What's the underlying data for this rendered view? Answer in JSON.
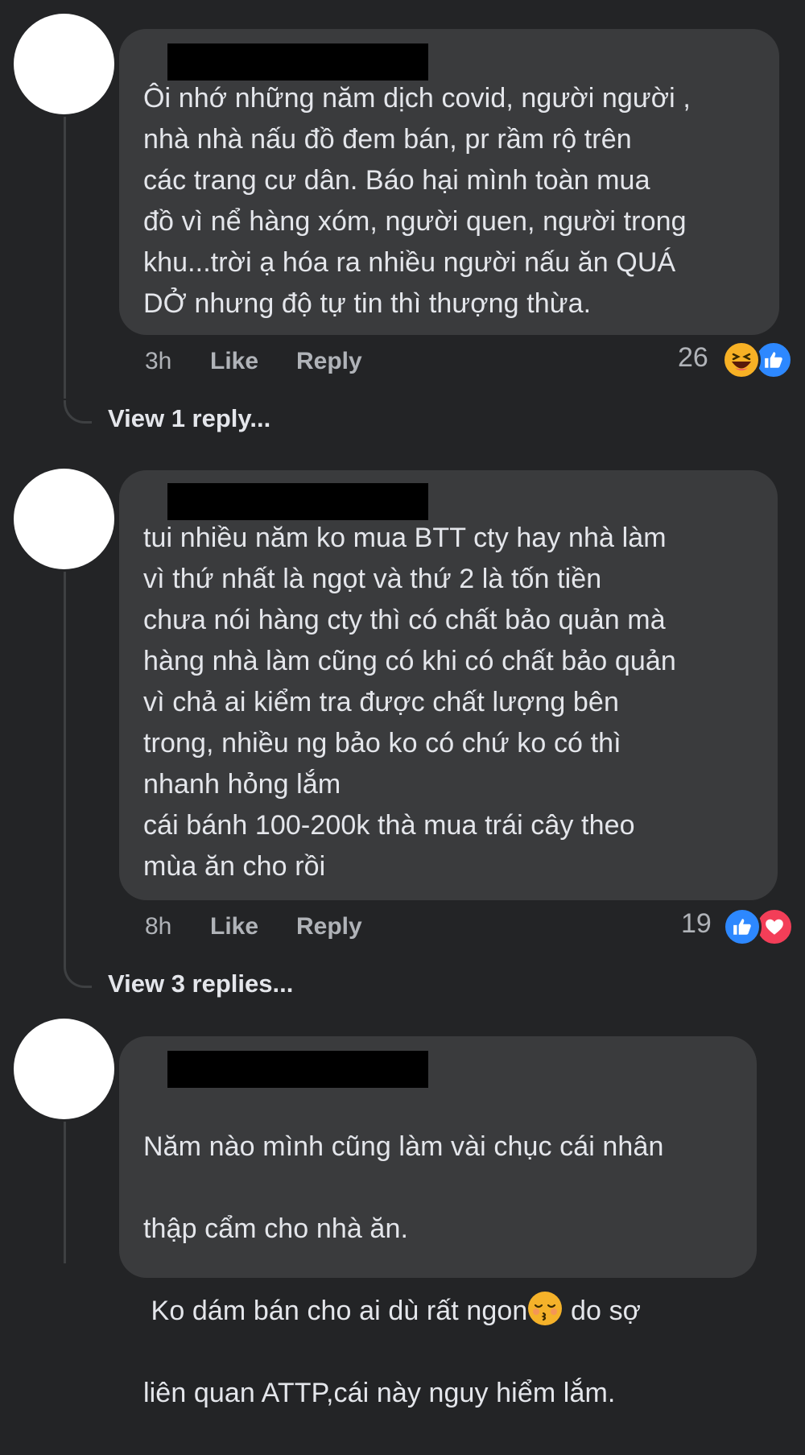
{
  "comments": [
    {
      "text": "Ôi nhớ những năm dịch covid, người người ,\nnhà nhà nấu đồ đem bán, pr rầm rộ trên\ncác trang cư dân. Báo hại mình toàn mua\nđồ vì nể hàng xóm, người quen, người trong\nkhu...trời ạ hóa ra nhiều người nấu ăn QUÁ\nDỞ nhưng độ tự tin thì thượng thừa.",
      "time": "3h",
      "like_label": "Like",
      "reply_label": "Reply",
      "reaction_count": "26",
      "reactions": [
        "haha-icon",
        "like-icon"
      ],
      "view_replies": "View 1 reply..."
    },
    {
      "text": "tui nhiều năm ko mua BTT cty hay nhà làm\nvì thứ nhất là ngọt và thứ 2 là tốn tiền\nchưa nói hàng cty thì có chất bảo quản mà\nhàng nhà làm cũng có khi có chất bảo quản\nvì chả ai kiểm tra được chất lượng bên\ntrong, nhiều ng bảo ko có chứ ko có thì\nnhanh hỏng lắm\ncái bánh 100-200k thà mua trái cây theo\nmùa ăn cho rồi",
      "time": "8h",
      "like_label": "Like",
      "reply_label": "Reply",
      "reaction_count": "19",
      "reactions": [
        "like-icon",
        "love-icon"
      ],
      "view_replies": "View 3 replies..."
    },
    {
      "text_line1": "Năm nào mình cũng làm vài chục cái nhân",
      "text_line2": "thập cẩm cho nhà ăn.",
      "text_line3a": " Ko dám bán cho ai dù rất ngon",
      "text_line3b": " do sợ",
      "text_line4": "liên quan ATTP,cái này nguy hiểm lắm.",
      "inline_emoji": "kissing-closed-eyes-emoji"
    }
  ],
  "colors": {
    "background": "#232426",
    "bubble": "#3a3b3d",
    "text": "#e4e6eb",
    "meta": "#b0b3b8",
    "like_blue": "#2d88ff",
    "love_red": "#f33e58",
    "haha_yellow": "#f7b125"
  }
}
